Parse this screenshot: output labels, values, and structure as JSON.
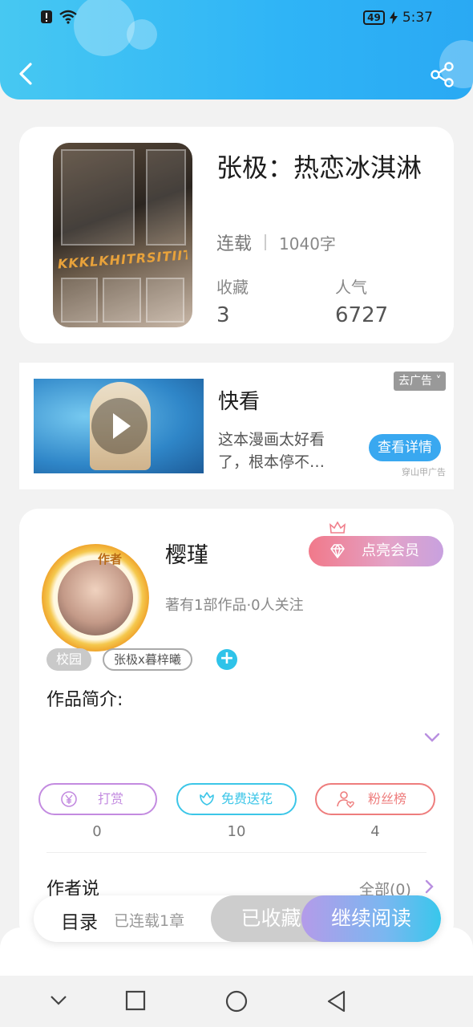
{
  "status_bar": {
    "battery": "49",
    "time": "5:37"
  },
  "book": {
    "title": "张极：热恋冰淇淋",
    "cover_text": "KKKLKHITRSITIIT",
    "status": "连载",
    "word_count": "1040字",
    "favorites_label": "收藏",
    "favorites_value": "3",
    "popularity_label": "人气",
    "popularity_value": "6727"
  },
  "ad": {
    "title": "快看",
    "description": "这本漫画太好看了，根本停不…",
    "dismiss_label": "去广告",
    "cta_label": "查看详情",
    "source": "穿山甲广告"
  },
  "author": {
    "avatar_badge": "作者",
    "name": "樱瑾",
    "vip_label": "点亮会员",
    "meta": "著有1部作品·0人关注",
    "tags": [
      "校园",
      "张极x暮梓曦"
    ],
    "add_tag": "+",
    "intro_title": "作品简介:",
    "actions": [
      {
        "label": "打赏",
        "count": "0",
        "icon": "yen-coin-icon",
        "color": "#c38be0"
      },
      {
        "label": "免费送花",
        "count": "10",
        "icon": "flower-icon",
        "color": "#3cc6e8"
      },
      {
        "label": "粉丝榜",
        "count": "4",
        "icon": "user-heart-icon",
        "color": "#ee7d7d"
      }
    ],
    "says_title": "作者说",
    "says_all": "全部(0)"
  },
  "bottom_bar": {
    "toc_label": "目录",
    "chapters_label": "已连载1章",
    "favorited_label": "已收藏",
    "continue_label": "继续阅读"
  }
}
